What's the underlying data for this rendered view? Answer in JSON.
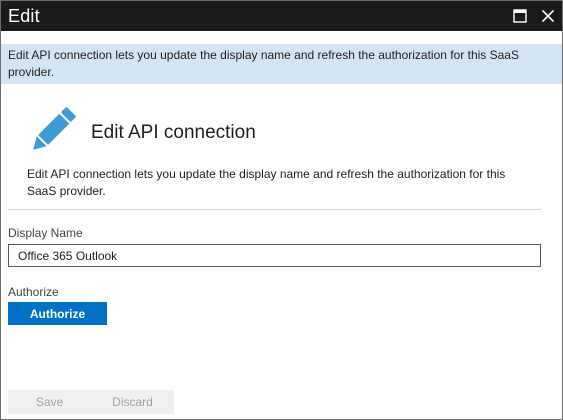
{
  "window": {
    "title": "Edit"
  },
  "info_banner": {
    "text": "Edit API connection lets you update the display name and refresh the authorization for this SaaS provider."
  },
  "header": {
    "icon": "pencil-icon",
    "title": "Edit API connection",
    "description": "Edit API connection lets you update the display name and refresh the authorization for this SaaS provider."
  },
  "form": {
    "display_name_label": "Display Name",
    "display_name_value": "Office 365 Outlook",
    "authorize_label": "Authorize",
    "authorize_button": "Authorize"
  },
  "footer": {
    "save_label": "Save",
    "discard_label": "Discard"
  },
  "colors": {
    "titlebar": "#1b1b1b",
    "info_banner": "#d2e5f5",
    "accent": "#0072c6",
    "pencil": "#3e9bd8"
  }
}
